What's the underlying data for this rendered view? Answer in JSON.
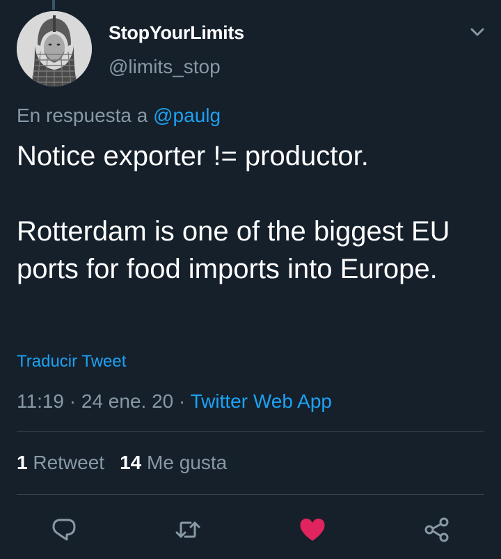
{
  "tweet": {
    "display_name": "StopYourLimits",
    "handle": "@limits_stop",
    "reply_prefix": "En respuesta a",
    "reply_mention": "@paulg",
    "text_line_1": "Notice exporter != productor.",
    "text_line_2": "Rotterdam is one of the biggest EU ports for food imports into Europe.",
    "translate_label": "Traducir Tweet",
    "timestamp": "11:19 · 24 ene. 20",
    "separator": " · ",
    "source": "Twitter Web App",
    "retweet_count": "1",
    "retweet_label": "Retweet",
    "like_count": "14",
    "like_label": "Me gusta"
  },
  "actions": {
    "reply_icon": "reply-icon",
    "retweet_icon": "retweet-icon",
    "like_icon": "heart-icon",
    "share_icon": "share-icon",
    "like_active": true
  },
  "colors": {
    "background": "#15202b",
    "primary_text": "#ffffff",
    "secondary_text": "#8899a6",
    "accent": "#1da1f2",
    "like": "#e0245e",
    "divider": "#38444d"
  }
}
